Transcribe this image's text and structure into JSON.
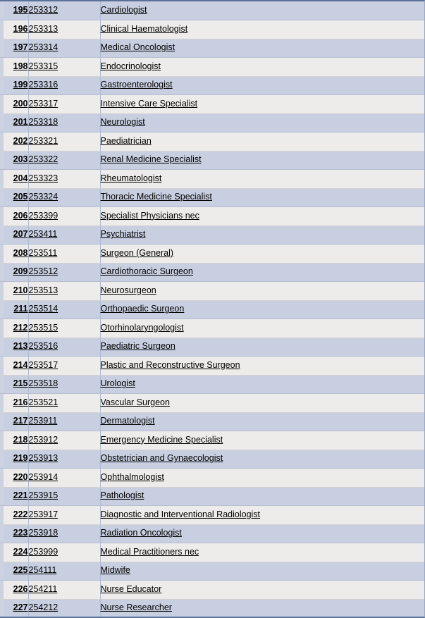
{
  "table": {
    "columns": {
      "row_number": "",
      "anzsco_code": "",
      "occupation_title": ""
    },
    "rows": [
      {
        "num": "195",
        "code": "253312",
        "title": "Cardiologist"
      },
      {
        "num": "196",
        "code": "253313",
        "title": "Clinical Haematologist"
      },
      {
        "num": "197",
        "code": "253314",
        "title": "Medical Oncologist"
      },
      {
        "num": "198",
        "code": "253315",
        "title": "Endocrinologist"
      },
      {
        "num": "199",
        "code": "253316",
        "title": "Gastroenterologist"
      },
      {
        "num": "200",
        "code": "253317",
        "title": "Intensive Care Specialist"
      },
      {
        "num": "201",
        "code": "253318",
        "title": "Neurologist"
      },
      {
        "num": "202",
        "code": "253321",
        "title": "Paediatrician"
      },
      {
        "num": "203",
        "code": "253322",
        "title": "Renal Medicine Specialist"
      },
      {
        "num": "204",
        "code": "253323",
        "title": "Rheumatologist"
      },
      {
        "num": "205",
        "code": "253324",
        "title": "Thoracic Medicine Specialist"
      },
      {
        "num": "206",
        "code": "253399",
        "title": "Specialist Physicians nec"
      },
      {
        "num": "207",
        "code": "253411",
        "title": "Psychiatrist"
      },
      {
        "num": "208",
        "code": "253511",
        "title": "Surgeon (General)"
      },
      {
        "num": "209",
        "code": "253512",
        "title": "Cardiothoracic Surgeon"
      },
      {
        "num": "210",
        "code": "253513",
        "title": "Neurosurgeon"
      },
      {
        "num": "211",
        "code": "253514",
        "title": "Orthopaedic Surgeon"
      },
      {
        "num": "212",
        "code": "253515",
        "title": "Otorhinolaryngologist"
      },
      {
        "num": "213",
        "code": "253516",
        "title": "Paediatric Surgeon"
      },
      {
        "num": "214",
        "code": "253517",
        "title": "Plastic and Reconstructive Surgeon"
      },
      {
        "num": "215",
        "code": "253518",
        "title": "Urologist"
      },
      {
        "num": "216",
        "code": "253521",
        "title": "Vascular Surgeon"
      },
      {
        "num": "217",
        "code": "253911",
        "title": "Dermatologist"
      },
      {
        "num": "218",
        "code": "253912",
        "title": "Emergency Medicine Specialist"
      },
      {
        "num": "219",
        "code": "253913",
        "title": "Obstetrician and Gynaecologist"
      },
      {
        "num": "220",
        "code": "253914",
        "title": "Ophthalmologist"
      },
      {
        "num": "221",
        "code": "253915",
        "title": "Pathologist"
      },
      {
        "num": "222",
        "code": "253917",
        "title": "Diagnostic and Interventional Radiologist"
      },
      {
        "num": "223",
        "code": "253918",
        "title": "Radiation Oncologist"
      },
      {
        "num": "224",
        "code": "253999",
        "title": "Medical Practitioners nec"
      },
      {
        "num": "225",
        "code": "254111",
        "title": "Midwife"
      },
      {
        "num": "226",
        "code": "254211",
        "title": "Nurse Educator"
      },
      {
        "num": "227",
        "code": "254212",
        "title": "Nurse Researcher"
      }
    ]
  },
  "colors": {
    "shaded_row": "#c8cfe0",
    "plain_row": "#edecea",
    "border": "#5b7199",
    "text": "#000000"
  }
}
